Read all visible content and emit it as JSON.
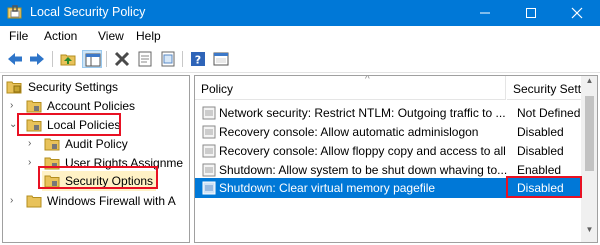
{
  "window": {
    "title": "Local Security Policy",
    "accent": "#0078d7",
    "minimize_glyph": "minimize-icon",
    "maximize_glyph": "maximize-icon",
    "close_glyph": "close-icon"
  },
  "menu": {
    "items": [
      "File",
      "Action",
      "View",
      "Help"
    ]
  },
  "toolbar": {
    "buttons": [
      "back-arrow-icon",
      "forward-arrow-icon",
      "up-folder-icon",
      "show-hide-tree-icon",
      "delete-icon",
      "properties-icon",
      "export-list-icon",
      "help-icon",
      "console-icon"
    ]
  },
  "tree": {
    "items": [
      {
        "label": "Security Settings",
        "level": 0
      },
      {
        "label": "Account Policies",
        "level": 1
      },
      {
        "label": "Local Policies",
        "level": 1,
        "expanded": true
      },
      {
        "label": "Audit Policy",
        "level": 2
      },
      {
        "label": "User Rights Assignme",
        "level": 2
      },
      {
        "label": "Security Options",
        "level": 2,
        "selected": true
      },
      {
        "label": "Windows Firewall with A",
        "level": 1
      }
    ]
  },
  "list": {
    "columns": [
      "Policy",
      "Security Sett"
    ],
    "rows": [
      {
        "policy": "Network security: Restrict NTLM: Outgoing traffic to ...",
        "setting": "Not Defined"
      },
      {
        "policy": "Recovery console: Allow automatic adminislogon",
        "setting": "Disabled"
      },
      {
        "policy": "Recovery console: Allow floppy copy and access to all drives...",
        "setting": "Disabled"
      },
      {
        "policy": "Shutdown: Allow system to be shut down whaving to...",
        "setting": "Enabled"
      },
      {
        "policy": "Shutdown: Clear virtual memory pagefile",
        "setting": "Disabled",
        "selected": true
      }
    ]
  },
  "colors": {
    "highlight_border": "#e81123",
    "selection": "#0078d7"
  }
}
